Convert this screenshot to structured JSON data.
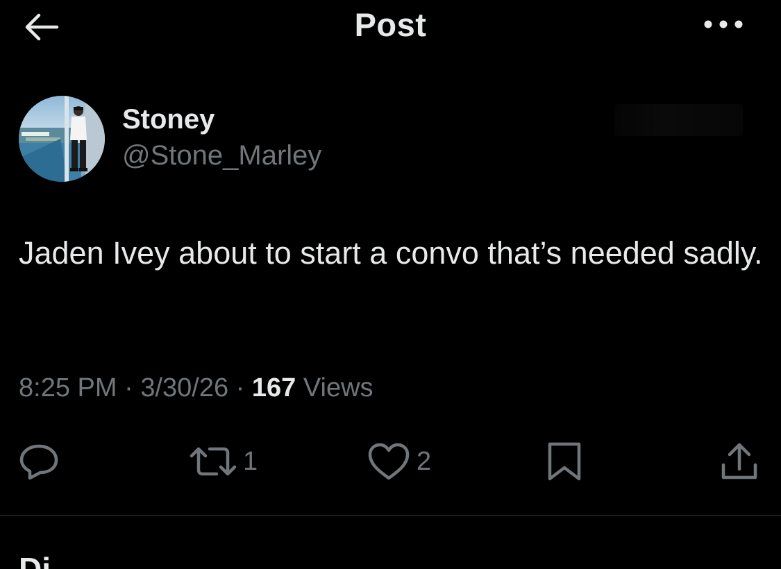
{
  "header": {
    "title": "Post",
    "back_icon": "arrow-left-icon",
    "more_icon": "ellipsis-horizontal-icon"
  },
  "author": {
    "display_name": "Stoney",
    "handle": "@Stone_Marley",
    "avatar_icon": "profile-photo"
  },
  "post": {
    "text": "Jaden Ivey about to start a convo that’s needed sadly."
  },
  "meta": {
    "time": "8:25 PM",
    "separator": " · ",
    "date": "3/30/26",
    "views_count": "167",
    "views_label": "Views"
  },
  "actions": {
    "reply_icon": "reply-bubble-icon",
    "repost_icon": "repost-icon",
    "repost_count": "1",
    "like_icon": "heart-icon",
    "like_count": "2",
    "bookmark_icon": "bookmark-icon",
    "share_icon": "share-upload-icon"
  },
  "next_section_peek": "Di",
  "colors": {
    "background": "#000000",
    "primary_text": "#e7e9ea",
    "secondary_text": "#71767b",
    "divider": "#2f3336"
  }
}
